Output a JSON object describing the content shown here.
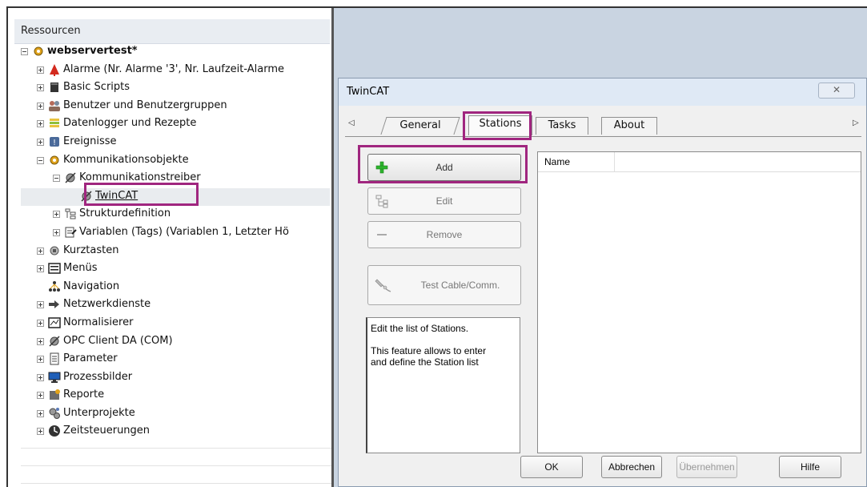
{
  "tree": {
    "header": "Ressourcen",
    "items": [
      {
        "label": "webservertest*",
        "indent": 0,
        "expander": "minus",
        "icon": "gear-icon",
        "bold": true
      },
      {
        "label": "Alarme (Nr. Alarme '3', Nr. Laufzeit-Alarme",
        "indent": 1,
        "expander": "plus",
        "icon": "alarm-bell-icon"
      },
      {
        "label": "Basic Scripts",
        "indent": 1,
        "expander": "plus",
        "icon": "script-icon"
      },
      {
        "label": "Benutzer und Benutzergruppen",
        "indent": 1,
        "expander": "plus",
        "icon": "users-icon"
      },
      {
        "label": "Datenlogger und Rezepte",
        "indent": 1,
        "expander": "plus",
        "icon": "database-icon"
      },
      {
        "label": "Ereignisse",
        "indent": 1,
        "expander": "plus",
        "icon": "event-icon"
      },
      {
        "label": "Kommunikationsobjekte",
        "indent": 1,
        "expander": "minus",
        "icon": "gear-icon"
      },
      {
        "label": "Kommunikationstreiber",
        "indent": 2,
        "expander": "minus",
        "icon": "driver-icon"
      },
      {
        "label": "TwinCAT",
        "indent": 3,
        "expander": "none",
        "icon": "driver-icon",
        "selected": true
      },
      {
        "label": "Strukturdefinition",
        "indent": 2,
        "expander": "plus",
        "icon": "structure-icon"
      },
      {
        "label": "Variablen (Tags) (Variablen 1, Letzter Hö",
        "indent": 2,
        "expander": "plus",
        "icon": "tags-icon"
      },
      {
        "label": "Kurztasten",
        "indent": 1,
        "expander": "plus",
        "icon": "shortcut-icon"
      },
      {
        "label": "Menüs",
        "indent": 1,
        "expander": "plus",
        "icon": "menu-icon"
      },
      {
        "label": "Navigation",
        "indent": 1,
        "expander": "none",
        "icon": "navigation-icon"
      },
      {
        "label": "Netzwerkdienste",
        "indent": 1,
        "expander": "plus",
        "icon": "network-icon"
      },
      {
        "label": "Normalisierer",
        "indent": 1,
        "expander": "plus",
        "icon": "normalizer-icon"
      },
      {
        "label": "OPC Client DA (COM)",
        "indent": 1,
        "expander": "plus",
        "icon": "opc-icon"
      },
      {
        "label": "Parameter",
        "indent": 1,
        "expander": "plus",
        "icon": "parameter-icon"
      },
      {
        "label": "Prozessbilder",
        "indent": 1,
        "expander": "plus",
        "icon": "monitor-icon"
      },
      {
        "label": "Reporte",
        "indent": 1,
        "expander": "plus",
        "icon": "report-icon"
      },
      {
        "label": "Unterprojekte",
        "indent": 1,
        "expander": "plus",
        "icon": "subprojects-icon"
      },
      {
        "label": "Zeitsteuerungen",
        "indent": 1,
        "expander": "plus",
        "icon": "clock-icon"
      }
    ]
  },
  "dialog": {
    "title": "TwinCAT",
    "close_glyph": "✕",
    "tab_prev_glyph": "◁",
    "tab_next_glyph": "▷",
    "tabs": [
      "General",
      "Stations",
      "Tasks",
      "About"
    ],
    "active_tab": "Stations",
    "buttons": {
      "add": "Add",
      "edit": "Edit",
      "remove": "Remove",
      "test": "Test Cable/Comm."
    },
    "description_lines": [
      "Edit the list of Stations.",
      "This feature allows to enter",
      "and define the Station list"
    ],
    "list_header": "Name",
    "footer": {
      "ok": "OK",
      "cancel": "Abbrechen",
      "apply": "Übernehmen",
      "help": "Hilfe"
    }
  },
  "colors": {
    "highlight": "#a0267f",
    "background_area": "#c9d4e1",
    "add_icon": "#2db52d"
  }
}
